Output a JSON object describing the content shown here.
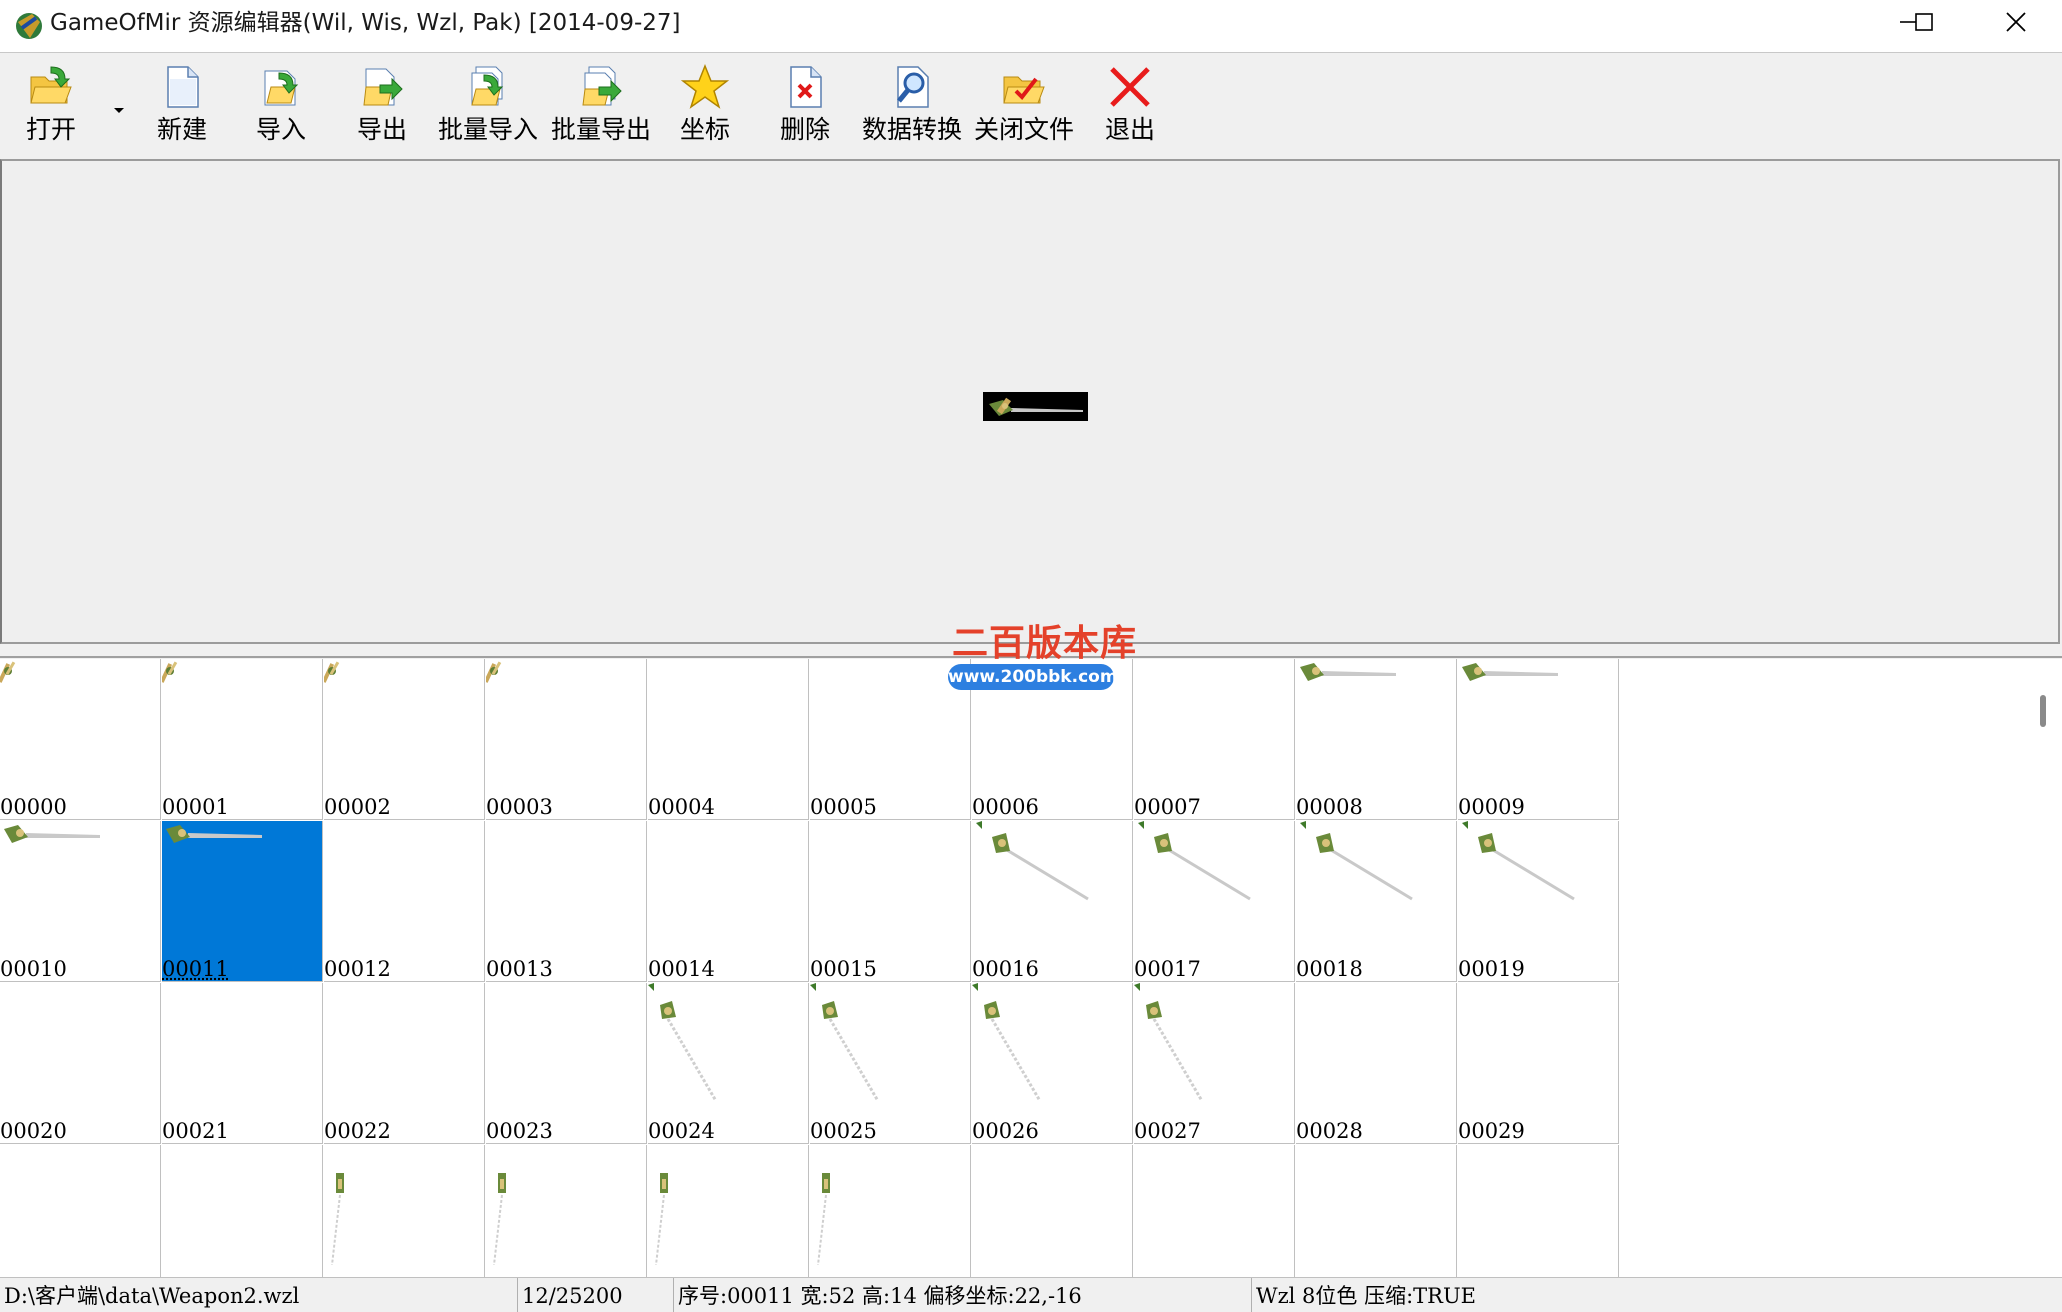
{
  "window": {
    "title": "GameOfMir 资源编辑器(Wil, Wis, Wzl, Pak) [2014-09-27]"
  },
  "toolbar": {
    "open": "打开",
    "new": "新建",
    "import": "导入",
    "export": "导出",
    "batch_import": "批量导入",
    "batch_export": "批量导出",
    "coords": "坐标",
    "delete": "删除",
    "convert": "数据转换",
    "close_file": "关闭文件",
    "exit": "退出"
  },
  "watermark": {
    "title": "二百版本库",
    "url": "www.200bbk.com"
  },
  "grid": {
    "selected_index": 11,
    "cells": [
      "00000",
      "00001",
      "00002",
      "00003",
      "00004",
      "00005",
      "00006",
      "00007",
      "00008",
      "00009",
      "00010",
      "00011",
      "00012",
      "00013",
      "00014",
      "00015",
      "00016",
      "00017",
      "00018",
      "00019",
      "00020",
      "00021",
      "00022",
      "00023",
      "00024",
      "00025",
      "00026",
      "00027",
      "00028",
      "00029",
      "",
      "",
      "",
      "",
      "",
      "",
      "",
      "",
      "",
      ""
    ],
    "sprite_kinds": [
      "small",
      "small",
      "small",
      "small",
      "none",
      "none",
      "none",
      "none",
      "horizontal",
      "horizontal",
      "horizontal",
      "horizontal",
      "none",
      "none",
      "none",
      "none",
      "diagonal",
      "diagonal",
      "diagonal",
      "diagonal",
      "none",
      "none",
      "none",
      "none",
      "steep",
      "steep",
      "steep",
      "steep",
      "none",
      "none",
      "none",
      "none",
      "vertical",
      "vertical",
      "vertical",
      "vertical",
      "none",
      "none",
      "none",
      "none"
    ]
  },
  "status": {
    "path": "D:\\客户端\\data\\Weapon2.wzl",
    "count": "12/25200",
    "info": "序号:00011 宽:52 高:14 偏移坐标:22,-16",
    "format": "Wzl 8位色 压缩:TRUE"
  },
  "colors": {
    "selection": "#0078d7",
    "watermark_red": "#e4412a",
    "watermark_blue": "#2d7fe0"
  }
}
